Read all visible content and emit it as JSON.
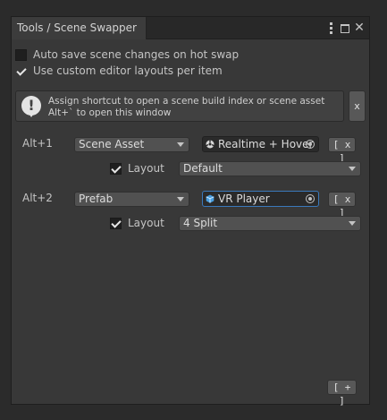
{
  "window": {
    "tab_title": "Tools / Scene Swapper",
    "close_glyph": "✕"
  },
  "options": {
    "auto_save": {
      "label": "Auto save scene changes on hot swap",
      "checked": false
    },
    "custom_layouts": {
      "label": "Use custom editor layouts per item",
      "checked": true
    }
  },
  "helpbox": {
    "icon_glyph": "!",
    "text": "Assign shortcut to open a scene build index or scene asset\nAlt+` to open this window",
    "close_label": "x"
  },
  "items": [
    {
      "shortcut": "Alt+1",
      "type": "Scene Asset",
      "object": "Realtime + Hover",
      "object_icon": "scene-asset-icon",
      "remove_label": "[ x ]",
      "layout_label": "Layout",
      "layout_checked": true,
      "layout_value": "Default"
    },
    {
      "shortcut": "Alt+2",
      "type": "Prefab",
      "object": "VR Player",
      "object_icon": "prefab-icon",
      "remove_label": "[ x ]",
      "layout_label": "Layout",
      "layout_checked": true,
      "layout_value": "4 Split"
    }
  ],
  "footer": {
    "add_label": "[ + ]"
  }
}
